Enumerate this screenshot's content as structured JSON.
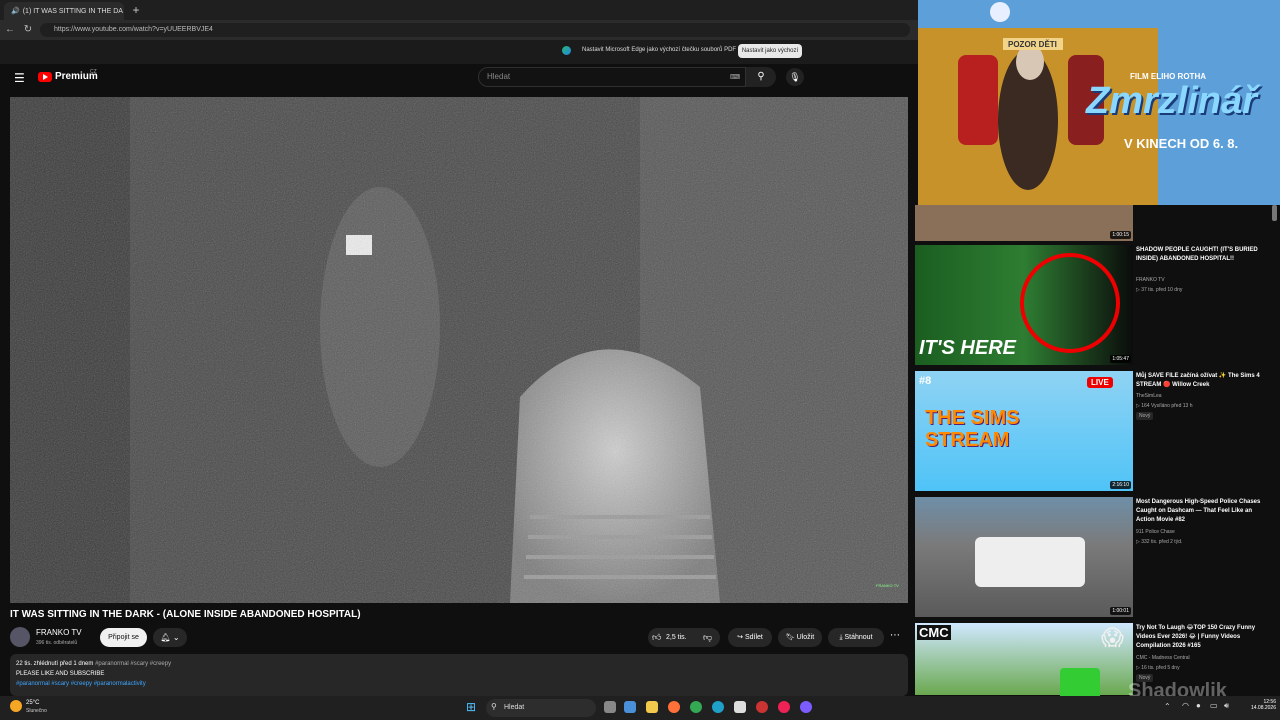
{
  "browser": {
    "tab_title": "(1) IT WAS SITTING IN THE DA",
    "url": "https://www.youtube.com/watch?v=yUUEERBVJE4",
    "infobar_text": "Nastavit Microsoft Edge jako výchozí čtečku souborů PDF",
    "infobar_button": "Nastavit jako výchozí"
  },
  "header": {
    "logo": "Premium",
    "region": "CZ",
    "search_placeholder": "Hledat"
  },
  "video": {
    "watermark": "FRANKO TV",
    "title": "IT WAS SITTING IN THE DARK - (ALONE INSIDE ABANDONED HOSPITAL)",
    "channel": "FRANKO TV",
    "subscribers": "396 tis. odběratelů",
    "join_label": "Připojit se",
    "likes": "2,5 tis.",
    "share_label": "Sdílet",
    "save_label": "Uložit",
    "download_label": "Stáhnout",
    "views_date": "22 tis. zhlédnutí  před 1 dnem",
    "tags_inline": "#paranormal #scary #creepy",
    "desc_line1": "PLEASE LIKE AND SUBSCRIBE",
    "desc_line2": "#paranormal #scary #creepy #paranormalactivity"
  },
  "ad": {
    "sign": "POZOR DĚTI",
    "top": "FILM ELIHO ROTHA",
    "title": "Zmrzlinář",
    "date": "V KINECH OD 6. 8."
  },
  "related": [
    {
      "duration": "1:00:15"
    },
    {
      "title": "SHADOW PEOPLE CAUGHT! (IT'S BURIED INSIDE) ABANDONED HOSPITAL!!",
      "channel": "FRANKO TV",
      "meta": "▷ 37 tis.  před 10 dny",
      "duration": "1:05:47",
      "overlay": "IT'S HERE"
    },
    {
      "title": "Můj SAVE FILE začíná ožívat ✨ The Sims 4 STREAM 🔴 Willow Creek",
      "channel": "TheSimLea",
      "meta": "▷ 164  Vysíláno před 13 h",
      "badge": "Nový",
      "duration": "2:16:10",
      "overlay": "THE SIMS STREAM",
      "live": "LIVE",
      "num": "#8"
    },
    {
      "title": "Most Dangerous High-Speed Police Chases Caught on Dashcam — That Feel Like an Action Movie #82",
      "channel": "911 Police Chase",
      "meta": "▷ 332 tis.  před 2 týd.",
      "duration": "1:00:01"
    },
    {
      "title": "Try Not To Laugh 😂TOP 150 Crazy Funny Videos Ever 2026! 😂 | Funny Videos Compilation 2026 #165",
      "channel": "CMC - Madness Central",
      "meta": "▷ 16 tis.  před 5 dny",
      "badge": "Nový",
      "overlay": "CMC"
    }
  ],
  "taskbar": {
    "temp": "25°C",
    "weather": "Slunečno",
    "search": "Hledat",
    "time": "12:56",
    "date": "14.08.2026"
  },
  "overlay_watermark": "Shadowlik"
}
